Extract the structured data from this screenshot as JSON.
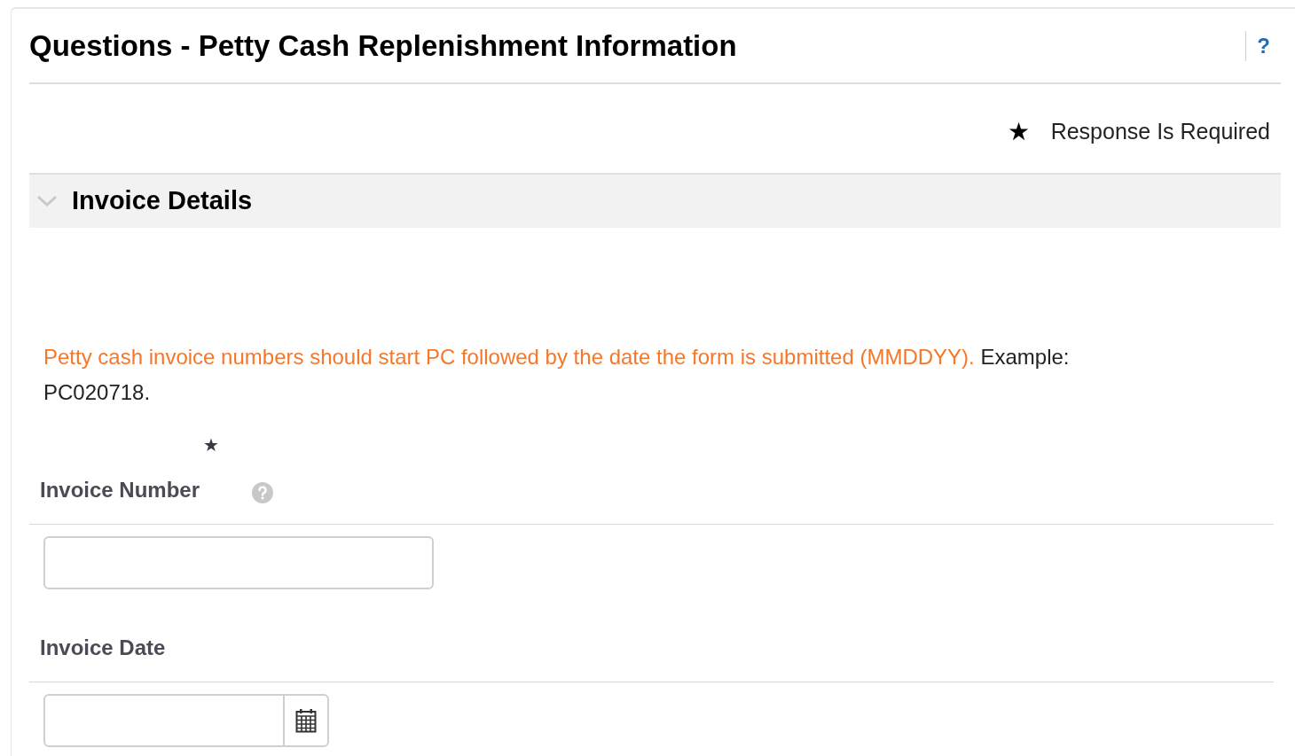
{
  "title": "Questions - Petty Cash Replenishment Information",
  "help": "?",
  "legend": {
    "mark": "★",
    "label": "Response Is Required"
  },
  "section": {
    "title": "Invoice Details",
    "expanded": true
  },
  "instruction": {
    "highlighted": "Petty cash invoice numbers should start PC followed by the date the form is submitted (MMDDYY).",
    "text": "Example: PC020718."
  },
  "fields": [
    {
      "kind": "text",
      "label": "Invoice Number",
      "required": true,
      "has_help": true
    },
    {
      "kind": "date",
      "label": "Invoice Date",
      "required": false,
      "has_help": false
    }
  ]
}
